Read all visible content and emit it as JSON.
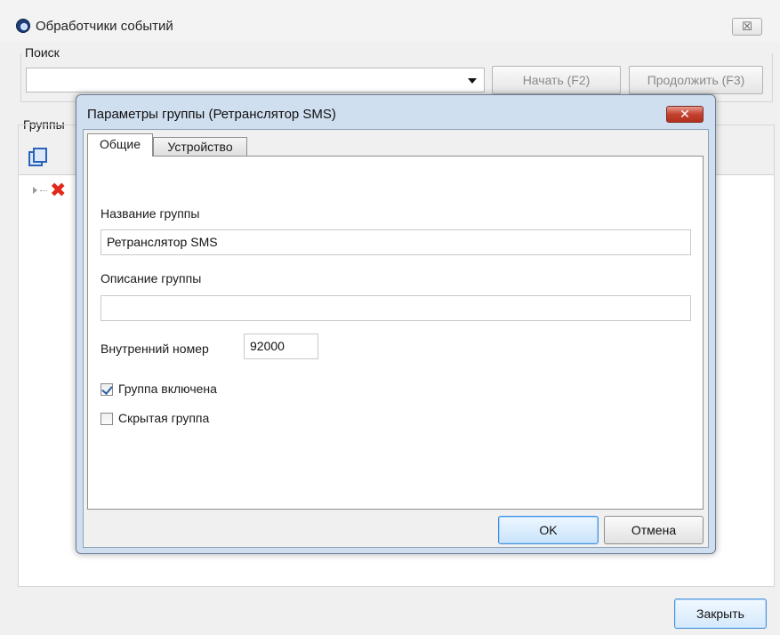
{
  "main": {
    "title": "Обработчики событий",
    "close_label": "☒",
    "search": {
      "label": "Поиск",
      "value": "",
      "start_label": "Начать (F2)",
      "continue_label": "Продолжить (F3)"
    },
    "groups_label": "Группы",
    "close_button_label": "Закрыть"
  },
  "dialog": {
    "title": "Параметры группы (Ретранслятор SMS)",
    "close_label": "✕",
    "tabs": [
      {
        "label": "Общие",
        "active": true
      },
      {
        "label": "Устройство",
        "active": false
      }
    ],
    "fields": {
      "group_name_label": "Название группы",
      "group_name_value": "Ретранслятор SMS",
      "group_desc_label": "Описание группы",
      "group_desc_value": "",
      "internal_number_label": "Внутренний номер",
      "internal_number_value": "92000",
      "enabled_label": "Группа  включена",
      "enabled_checked": true,
      "hidden_label": "Скрытая группа",
      "hidden_checked": false
    },
    "ok_label": "OK",
    "cancel_label": "Отмена"
  },
  "icons": {
    "app": "app-gear-icon",
    "copy": "copy-icon",
    "delete": "red-x-icon",
    "expander": "tree-expander-icon"
  }
}
